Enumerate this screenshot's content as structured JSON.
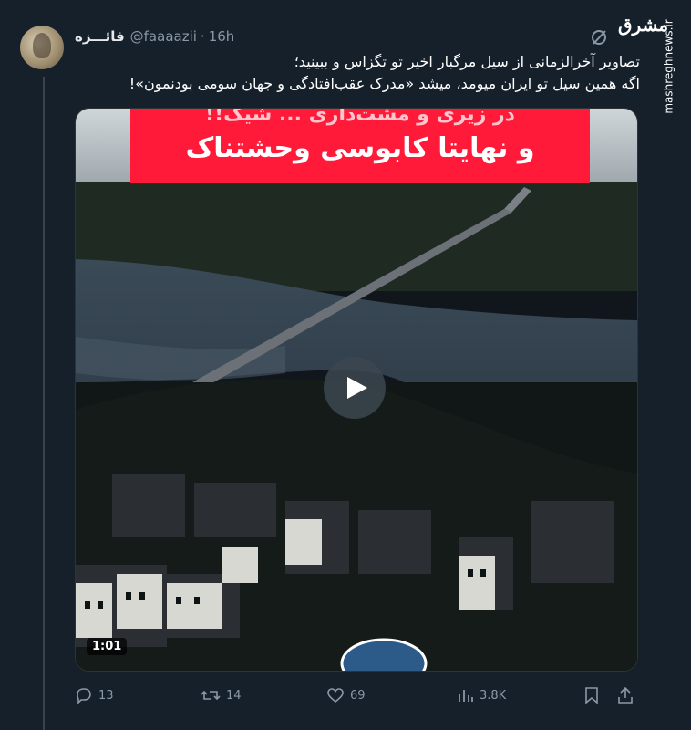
{
  "tweet": {
    "display_name": "فائـــزه",
    "handle": "@faaaazii",
    "separator": "·",
    "time": "16h",
    "text_line1": "تصاویر آخرالزمانی از سیل مرگبار اخیر تو تگزاس و ببینید؛",
    "text_line2": "اگه همین سیل تو ایران میومد، میشد «مدرک عقب‌افتادگی و جهان سومی بودنمون»!"
  },
  "media": {
    "caption_line1": "در زیری و مشت‌داری ... شیک!!",
    "caption_line2": "و نهایتا کابوسی وحشتناک",
    "duration": "1:01"
  },
  "actions": {
    "replies": "13",
    "reposts": "14",
    "likes": "69",
    "views": "3.8K"
  },
  "watermark": {
    "logo": "مشرق",
    "url": "mashreghnews.ir"
  },
  "icons": {
    "grok": "grok-icon",
    "play": "play-icon",
    "reply": "reply-icon",
    "repost": "repost-icon",
    "like": "heart-icon",
    "views": "views-icon",
    "bookmark": "bookmark-icon",
    "share": "share-icon"
  }
}
